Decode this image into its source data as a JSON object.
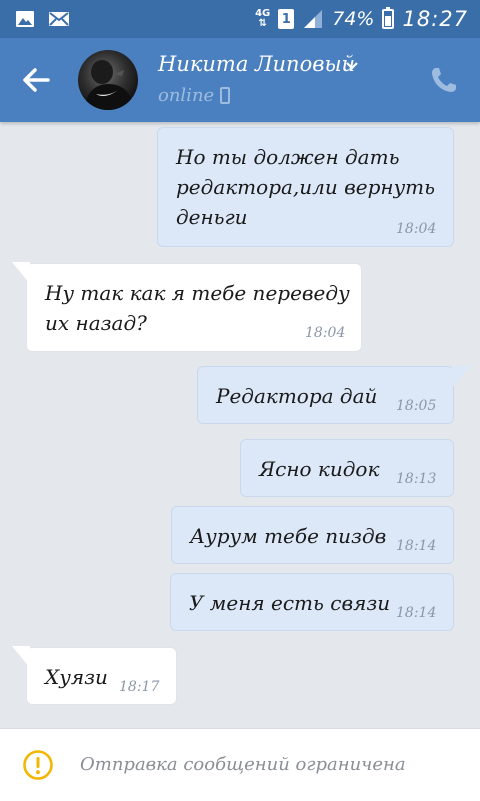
{
  "status_bar": {
    "network": "4G",
    "sim": "1",
    "battery_percent": "74%",
    "battery_level": 0.74,
    "time": "18:27"
  },
  "header": {
    "contact_name": "Никита Липовый",
    "presence": "online"
  },
  "messages": [
    {
      "direction": "out",
      "lines": [
        "Но ты должен дать",
        "редактора,или вернуть",
        "деньги"
      ],
      "time": "18:04"
    },
    {
      "direction": "in",
      "lines": [
        "Ну так как я тебе переведу",
        "их назад?"
      ],
      "time": "18:04"
    },
    {
      "direction": "out",
      "lines": [
        "Редактора дай"
      ],
      "time": "18:05"
    },
    {
      "direction": "out",
      "lines": [
        "Ясно кидок"
      ],
      "time": "18:13"
    },
    {
      "direction": "out",
      "lines": [
        "Аурум тебе пиздв"
      ],
      "time": "18:14"
    },
    {
      "direction": "out",
      "lines": [
        "У меня есть связи"
      ],
      "time": "18:14"
    },
    {
      "direction": "in",
      "lines": [
        "Хуязи"
      ],
      "time": "18:17"
    }
  ],
  "footer": {
    "notice": "Отправка сообщений ограничена"
  },
  "colors": {
    "status_bar": "#3a6ea8",
    "header": "#4a80bf",
    "outgoing_bubble": "#dce8f8",
    "incoming_bubble": "#ffffff",
    "warning": "#f2b705"
  }
}
